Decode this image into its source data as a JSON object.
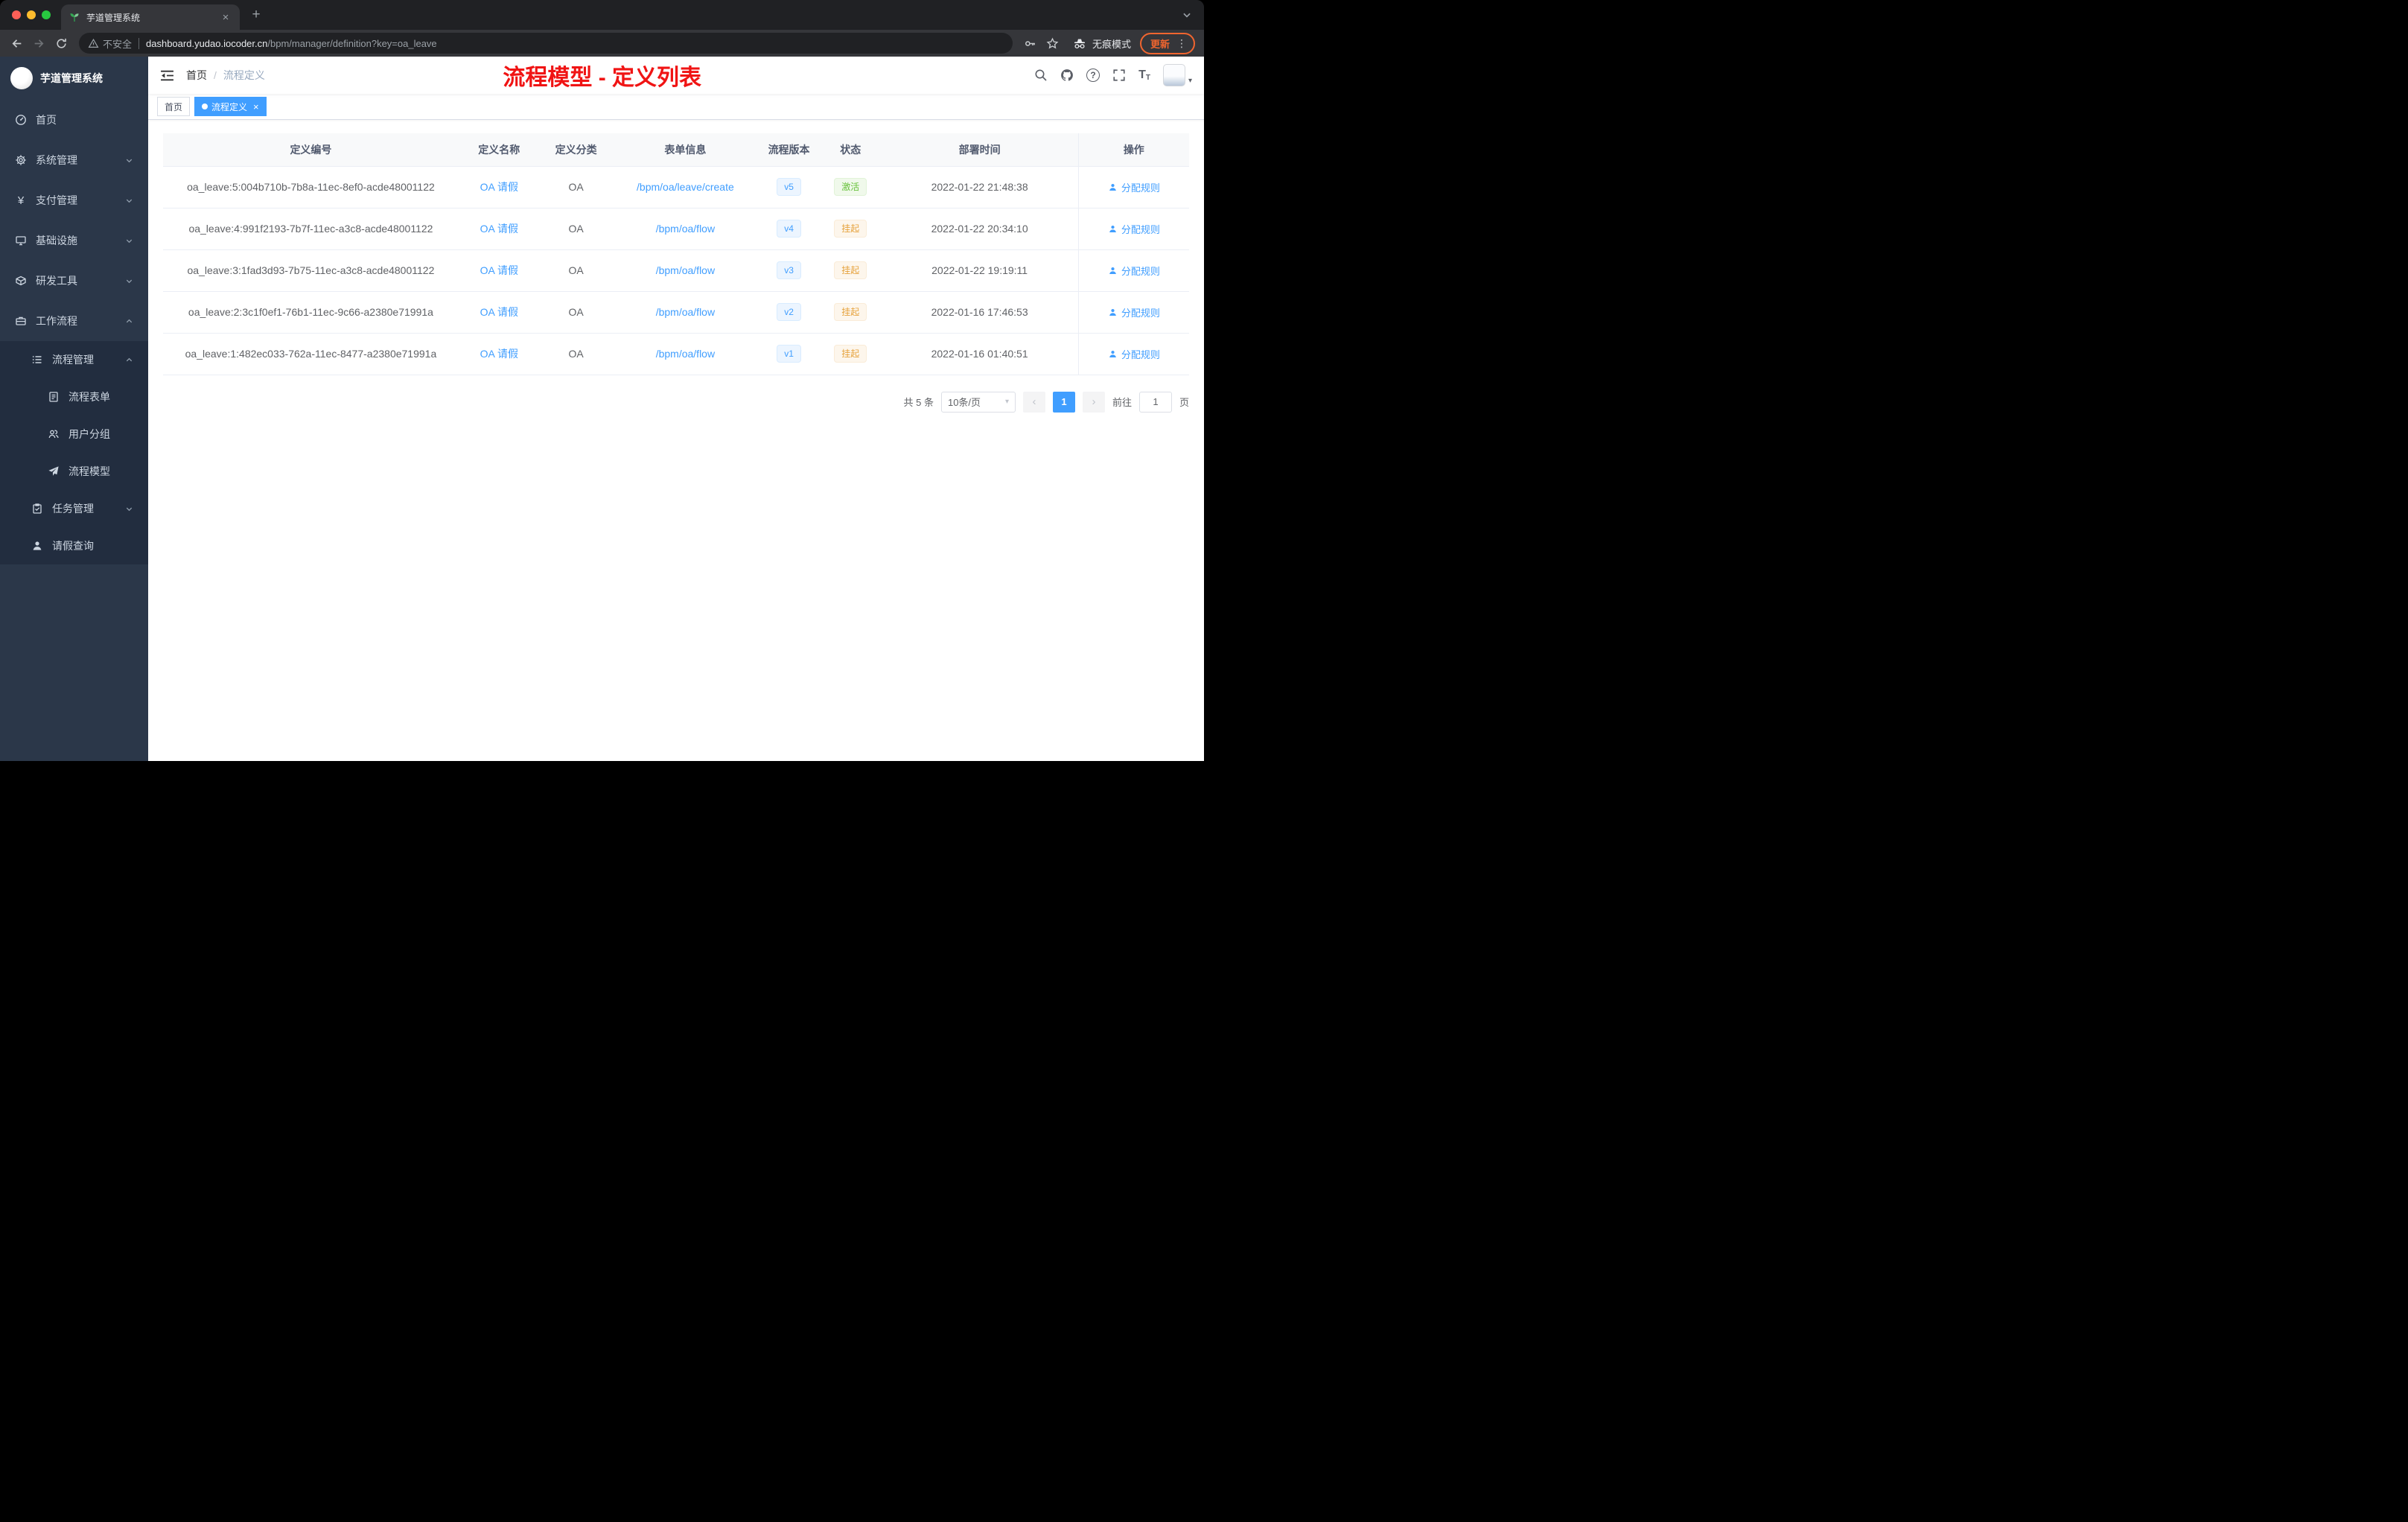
{
  "browser": {
    "tab_title": "芋道管理系统",
    "security_label": "不安全",
    "url_host": "dashboard.yudao.iocoder.cn",
    "url_path": "/bpm/manager/definition?key=oa_leave",
    "incognito_label": "无痕模式",
    "update_label": "更新"
  },
  "icons": {
    "yen": "¥",
    "close": "×",
    "plus": "+",
    "dots": "⋮",
    "question": "?",
    "caret": "▾",
    "chevron_left": "‹",
    "chevron_right": "›",
    "font_large": "T",
    "font_small": "T"
  },
  "sidebar": {
    "logo_title": "芋道管理系统",
    "items": [
      {
        "label": "首页"
      },
      {
        "label": "系统管理"
      },
      {
        "label": "支付管理"
      },
      {
        "label": "基础设施"
      },
      {
        "label": "研发工具"
      },
      {
        "label": "工作流程"
      },
      {
        "label": "流程管理"
      },
      {
        "label": "流程表单"
      },
      {
        "label": "用户分组"
      },
      {
        "label": "流程模型"
      },
      {
        "label": "任务管理"
      },
      {
        "label": "请假查询"
      }
    ]
  },
  "header": {
    "breadcrumb_home": "首页",
    "breadcrumb_sep": "/",
    "breadcrumb_current": "流程定义",
    "annotation": "流程模型 - 定义列表",
    "annotation_color": "#f01414"
  },
  "tags": {
    "home": "首页",
    "current": "流程定义"
  },
  "table": {
    "columns": [
      "定义编号",
      "定义名称",
      "定义分类",
      "表单信息",
      "流程版本",
      "状态",
      "部署时间",
      "操作"
    ],
    "rows": [
      {
        "id": "oa_leave:5:004b710b-7b8a-11ec-8ef0-acde48001122",
        "name": "OA 请假",
        "category": "OA",
        "form": "/bpm/oa/leave/create",
        "version": "v5",
        "status": "激活",
        "status_type": "success",
        "deploy_time": "2022-01-22 21:48:38",
        "action": "分配规则"
      },
      {
        "id": "oa_leave:4:991f2193-7b7f-11ec-a3c8-acde48001122",
        "name": "OA 请假",
        "category": "OA",
        "form": "/bpm/oa/flow",
        "version": "v4",
        "status": "挂起",
        "status_type": "warning",
        "deploy_time": "2022-01-22 20:34:10",
        "action": "分配规则"
      },
      {
        "id": "oa_leave:3:1fad3d93-7b75-11ec-a3c8-acde48001122",
        "name": "OA 请假",
        "category": "OA",
        "form": "/bpm/oa/flow",
        "version": "v3",
        "status": "挂起",
        "status_type": "warning",
        "deploy_time": "2022-01-22 19:19:11",
        "action": "分配规则"
      },
      {
        "id": "oa_leave:2:3c1f0ef1-76b1-11ec-9c66-a2380e71991a",
        "name": "OA 请假",
        "category": "OA",
        "form": "/bpm/oa/flow",
        "version": "v2",
        "status": "挂起",
        "status_type": "warning",
        "deploy_time": "2022-01-16 17:46:53",
        "action": "分配规则"
      },
      {
        "id": "oa_leave:1:482ec033-762a-11ec-8477-a2380e71991a",
        "name": "OA 请假",
        "category": "OA",
        "form": "/bpm/oa/flow",
        "version": "v1",
        "status": "挂起",
        "status_type": "warning",
        "deploy_time": "2022-01-16 01:40:51",
        "action": "分配规则"
      }
    ]
  },
  "pagination": {
    "total": "共 5 条",
    "page_size": "10条/页",
    "current_page": "1",
    "goto_label": "前往",
    "goto_value": "1",
    "goto_suffix": "页"
  },
  "colors": {
    "accent": "#409eff",
    "success": "#67c23a",
    "warning": "#e6a23c",
    "sidebar_bg": "#2b3749",
    "submenu_bg": "#222d3f"
  }
}
